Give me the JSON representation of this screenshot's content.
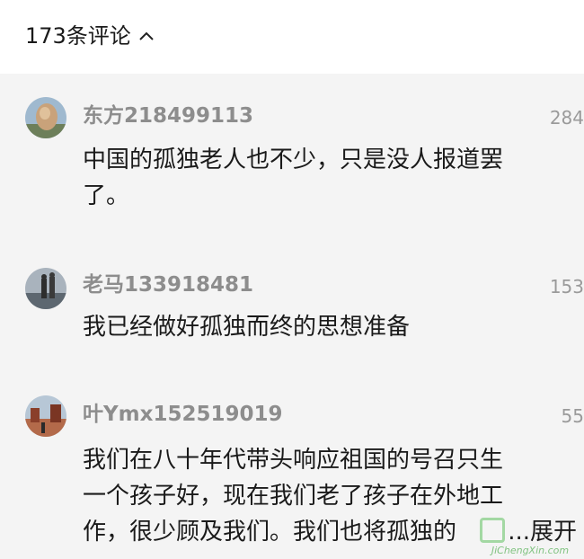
{
  "header": {
    "comment_count_label": "173条评论"
  },
  "comments": [
    {
      "username": "东方218499113",
      "likes": "284",
      "text_lines": [
        "中国的孤独老人也不少，只是没人报道罢",
        "了。"
      ]
    },
    {
      "username": "老马133918481",
      "likes": "153",
      "text_lines": [
        "我已经做好孤独而终的思想准备"
      ]
    },
    {
      "username": "叶Ymx152519019",
      "likes": "55",
      "text_lines": [
        "我们在八十年代带头响应祖国的号召只生",
        "一个孩子好，现在我们老了孩子在外地工",
        "作，很少顾及我们。我们也将孤独的"
      ],
      "expand_label": "...展开"
    }
  ],
  "watermark": {
    "text": "JiChengXin.com"
  },
  "colors": {
    "background": "#f4f4f4",
    "header_bg": "#ffffff",
    "username": "#8d8d8d",
    "body_text": "#1a1a1a",
    "likes": "#9a9a9a"
  },
  "icons": {
    "collapse": "chevron-up-icon"
  }
}
